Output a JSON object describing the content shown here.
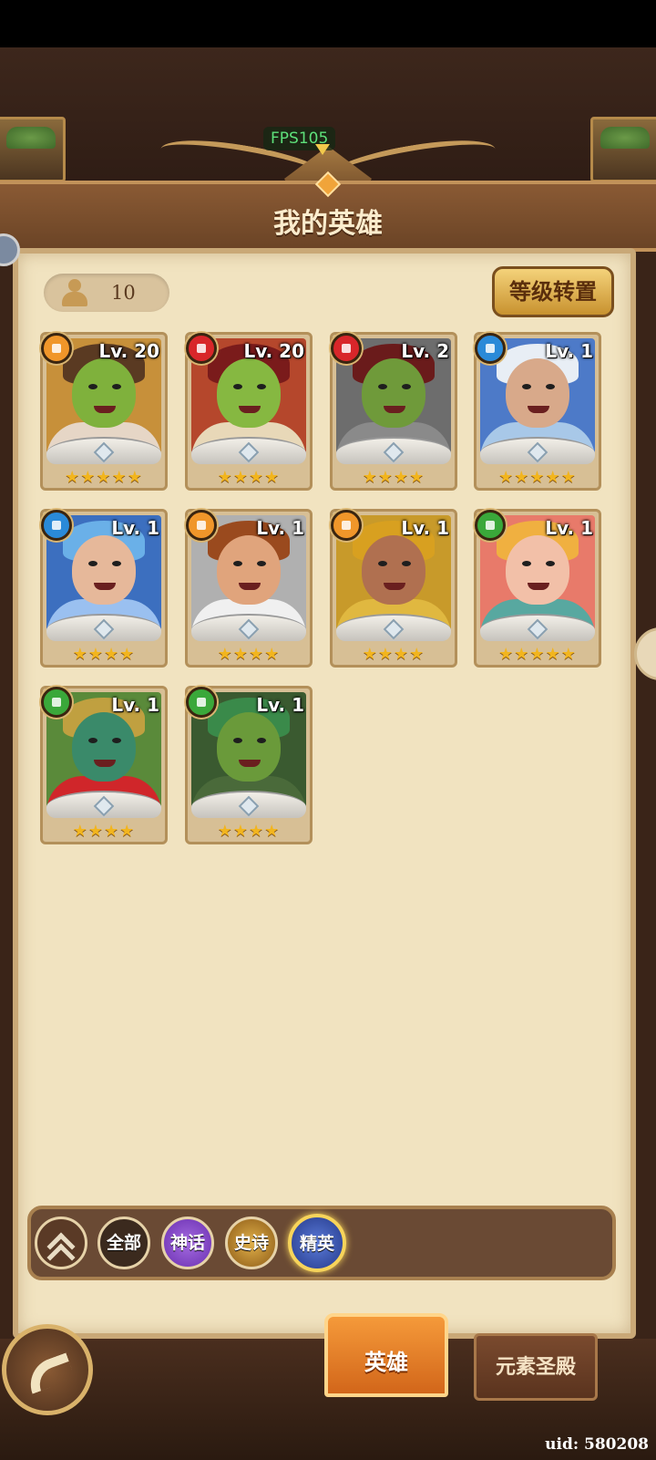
{
  "overlay": {
    "fps": "FPS105"
  },
  "header": {
    "title": "我的英雄"
  },
  "hero_count": {
    "value": "10"
  },
  "buttons": {
    "level_transfer": "等级转置"
  },
  "heroes": [
    {
      "level": "Lv. 20",
      "stars": "★★★★★",
      "element": "earth",
      "elem_color": "#f0962a",
      "skin": "#7fb13c",
      "hair": "#5a3a22",
      "bg": "#c7903a",
      "shoulders": "#e6d6c6"
    },
    {
      "level": "Lv. 20",
      "stars": "★★★★",
      "element": "fire",
      "elem_color": "#d8262a",
      "skin": "#86b841",
      "hair": "#7a1b1b",
      "bg": "#b5472c",
      "shoulders": "#e8d8b8"
    },
    {
      "level": "Lv. 2",
      "stars": "★★★★",
      "element": "fire",
      "elem_color": "#d8262a",
      "skin": "#6f9a3a",
      "hair": "#6a1b1b",
      "bg": "#6d6d6d",
      "shoulders": "#8a8a8a"
    },
    {
      "level": "Lv. 1",
      "stars": "★★★★★",
      "element": "water",
      "elem_color": "#2a8ad8",
      "skin": "#d8a98a",
      "hair": "#e8eef5",
      "bg": "#4d7ac8",
      "shoulders": "#a8c8e8"
    },
    {
      "level": "Lv. 1",
      "stars": "★★★★",
      "element": "water",
      "elem_color": "#2a8ad8",
      "skin": "#e6b89a",
      "hair": "#6ab0e8",
      "bg": "#3c6fbf",
      "shoulders": "#9ac0f0"
    },
    {
      "level": "Lv. 1",
      "stars": "★★★★",
      "element": "earth",
      "elem_color": "#f0962a",
      "skin": "#e0a47c",
      "hair": "#9a4a1e",
      "bg": "#b0b0b0",
      "shoulders": "#f0f0f0"
    },
    {
      "level": "Lv. 1",
      "stars": "★★★★",
      "element": "earth",
      "elem_color": "#f0962a",
      "skin": "#b07050",
      "hair": "#d8a020",
      "bg": "#c89a2a",
      "shoulders": "#e0b840"
    },
    {
      "level": "Lv. 1",
      "stars": "★★★★★",
      "element": "wind",
      "elem_color": "#3aa83a",
      "skin": "#f2c0a8",
      "hair": "#f0b040",
      "bg": "#e87a6a",
      "shoulders": "#58a8a0"
    },
    {
      "level": "Lv. 1",
      "stars": "★★★★",
      "element": "wind",
      "elem_color": "#3aa83a",
      "skin": "#3a8a6a",
      "hair": "#c0a040",
      "bg": "#5a8a3a",
      "shoulders": "#d0262a"
    },
    {
      "level": "Lv. 1",
      "stars": "★★★★",
      "element": "wind",
      "elem_color": "#3aa83a",
      "skin": "#6a9a3a",
      "hair": "#3a8a4a",
      "bg": "#3a5a30",
      "shoulders": "#4a6a3a"
    }
  ],
  "filters": {
    "all": "全部",
    "mythic": "神话",
    "epic": "史诗",
    "elite": "精英"
  },
  "tabs": {
    "heroes": "英雄",
    "element_temple": "元素圣殿"
  },
  "footer": {
    "uid": "uid: 580208"
  }
}
